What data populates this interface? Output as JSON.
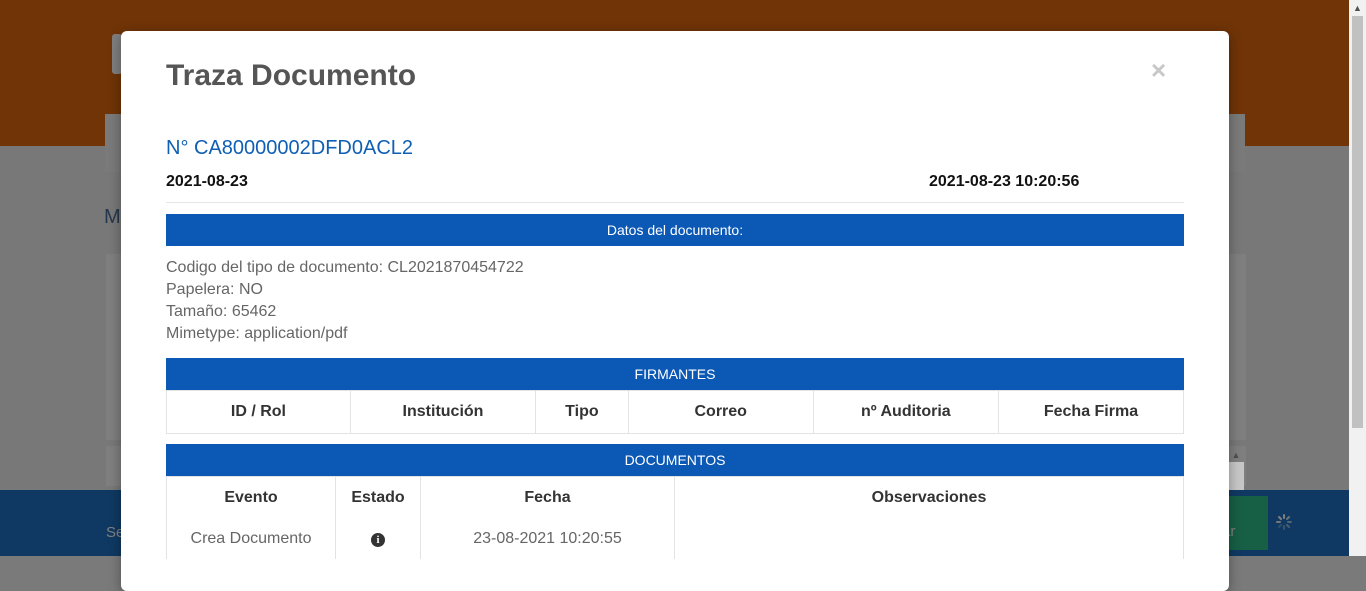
{
  "background": {
    "partial_letter": "M",
    "footer_partial_text": "Se",
    "green_button_partial": "ar"
  },
  "modal": {
    "title": "Traza Documento",
    "close_label": "×",
    "doc_number": "N° CA80000002DFD0ACL2",
    "date_left": "2021-08-23",
    "date_right": "2021-08-23 10:20:56",
    "datos_header": "Datos del documento:",
    "details": [
      "Codigo del tipo de documento: CL2021870454722",
      "Papelera: NO",
      "Tamaño: 65462",
      "Mimetype: application/pdf"
    ],
    "firmantes": {
      "header": "FIRMANTES",
      "columns": [
        "ID / Rol",
        "Institución",
        "Tipo",
        "Correo",
        "nº Auditoria",
        "Fecha Firma"
      ]
    },
    "documentos": {
      "header": "DOCUMENTOS",
      "columns": [
        "Evento",
        "Estado",
        "Fecha",
        "Observaciones"
      ],
      "rows": [
        {
          "evento": "Crea Documento",
          "estado_icon": "info-circle-icon",
          "fecha": "23-08-2021 10:20:55",
          "observaciones": ""
        }
      ]
    }
  },
  "icons": {
    "close": "close-icon",
    "info": "info-circle-icon",
    "spinner": "loading-spinner-icon"
  },
  "colors": {
    "section_header": "#0b58b5",
    "doc_number": "#0f5fb4",
    "page_header": "#e0680f",
    "footer": "#1e73c5"
  }
}
